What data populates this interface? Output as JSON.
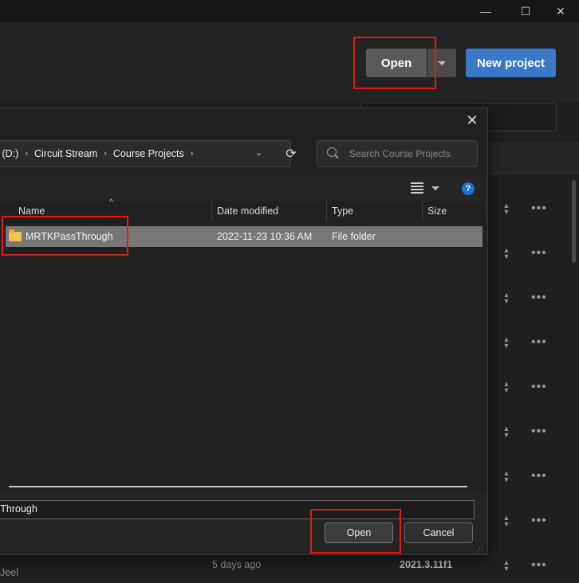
{
  "window": {
    "minimize_glyph": "—",
    "maximize_glyph": "☐",
    "close_glyph": "✕"
  },
  "header": {
    "open_label": "Open",
    "new_project_label": "New project",
    "accent": "#3a79c8"
  },
  "dialog": {
    "close_glyph": "✕",
    "breadcrumb": [
      "N (D:)",
      "Circuit Stream",
      "Course Projects"
    ],
    "search_placeholder": "Search Course Projects",
    "help_glyph": "?",
    "columns": {
      "name": "Name",
      "date": "Date modified",
      "type": "Type",
      "size": "Size"
    },
    "files": [
      {
        "name": "MRTKPassThrough",
        "date": "2022-11-23 10:36 AM",
        "type": "File folder",
        "size": ""
      }
    ],
    "filename_value": "sThrough",
    "open_label": "Open",
    "cancel_label": "Cancel"
  },
  "projects_list": {
    "bottom_name": "Jeel",
    "bottom_modified": "5 days ago",
    "bottom_version": "2021.3.11f1"
  },
  "annotation_color": "#e01b1b"
}
